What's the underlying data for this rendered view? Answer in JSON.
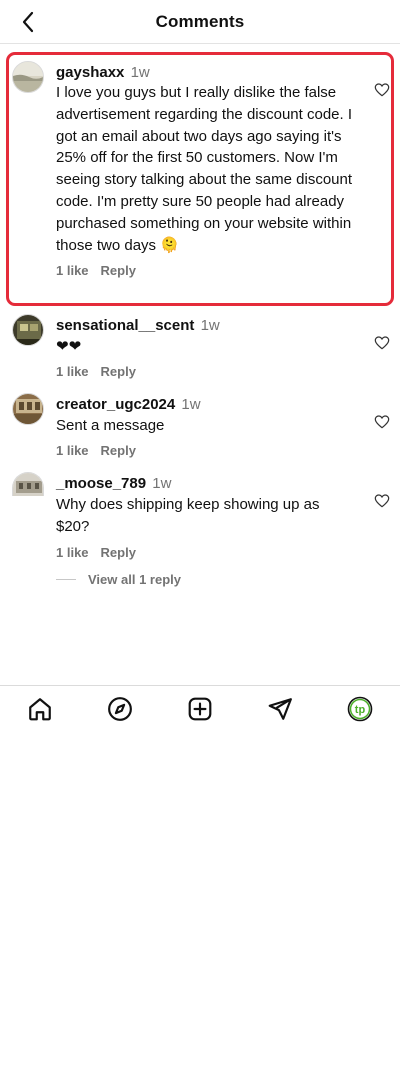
{
  "header": {
    "title": "Comments"
  },
  "comments": [
    {
      "username": "gayshaxx",
      "time": "1w",
      "text": "I love you guys but I really dislike the false advertisement regarding the discount code. I got an email about two days ago saying it's 25% off for the first 50 customers. Now I'm seeing story talking about the same discount code. I'm pretty sure 50 people had already purchased something on your website within those two days 🫠",
      "likes": "1 like",
      "reply": "Reply"
    },
    {
      "username": "sensational__scent",
      "time": "1w",
      "text": "❤❤",
      "likes": "1 like",
      "reply": "Reply"
    },
    {
      "username": "creator_ugc2024",
      "time": "1w",
      "text": "Sent a message",
      "likes": "1 like",
      "reply": "Reply"
    },
    {
      "username": "_moose_789",
      "time": "1w",
      "text": "Why does shipping keep showing up as $20?",
      "likes": "1 like",
      "reply": "Reply"
    }
  ],
  "view_replies": "View all 1 reply",
  "nav": {
    "items": [
      "home-icon",
      "explore-icon",
      "create-icon",
      "direct-icon",
      "profile-icon"
    ],
    "profile_initials": "tp",
    "profile_color": "#4caf2a"
  },
  "colors": {
    "highlight": "#e52b3a",
    "muted": "#737373"
  }
}
